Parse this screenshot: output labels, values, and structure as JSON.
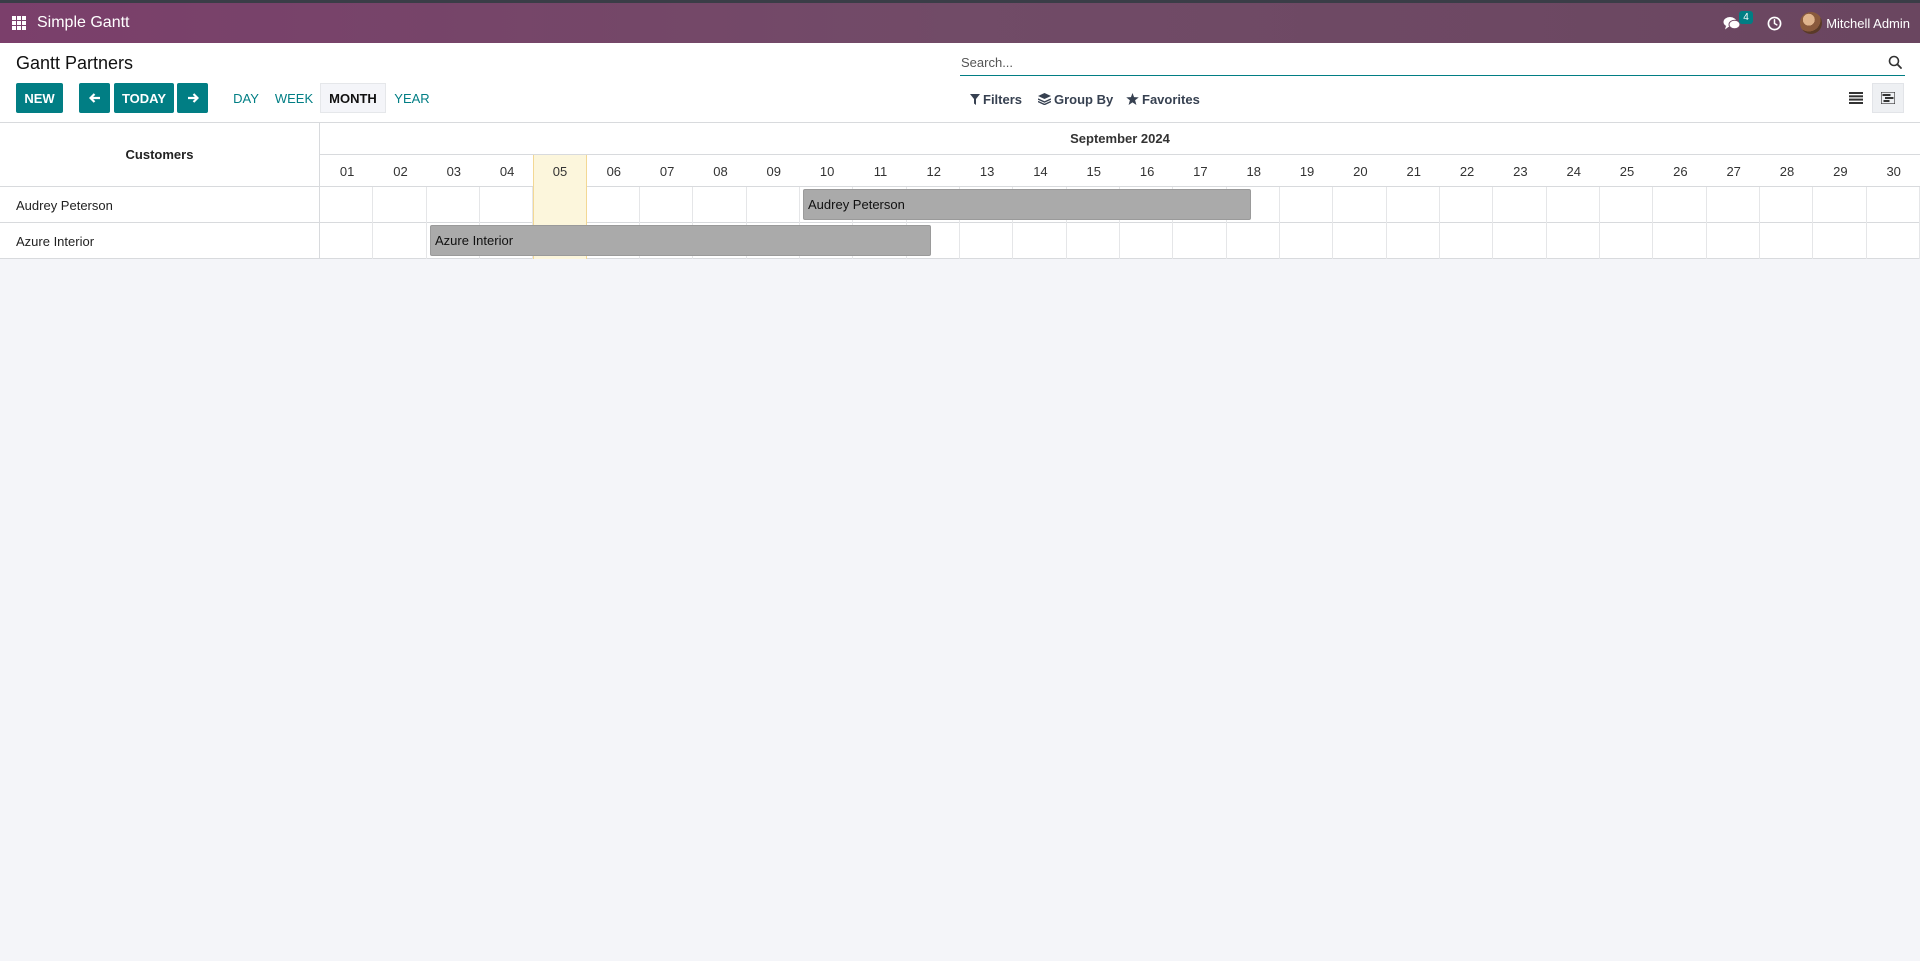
{
  "navbar": {
    "app_title": "Simple Gantt",
    "chat_badge": "4",
    "user_name": "Mitchell Admin",
    "icons": [
      "apps-grid-icon",
      "chat-icon",
      "clock-icon",
      "avatar"
    ]
  },
  "control": {
    "page_title": "Gantt Partners",
    "new_label": "NEW",
    "today_label": "TODAY",
    "scales": [
      "DAY",
      "WEEK",
      "MONTH",
      "YEAR"
    ],
    "active_scale": "MONTH",
    "search_placeholder": "Search...",
    "filters_label": "Filters",
    "groupby_label": "Group By",
    "favorites_label": "Favorites"
  },
  "gantt": {
    "row_header": "Customers",
    "month_label": "September 2024",
    "today_day": "05",
    "days": [
      "01",
      "02",
      "03",
      "04",
      "05",
      "06",
      "07",
      "08",
      "09",
      "10",
      "11",
      "12",
      "13",
      "14",
      "15",
      "16",
      "17",
      "18",
      "19",
      "20",
      "21",
      "22",
      "23",
      "24",
      "25",
      "26",
      "27",
      "28",
      "29",
      "30"
    ],
    "rows": [
      {
        "label": "Audrey Peterson",
        "pill": "Audrey Peterson"
      },
      {
        "label": "Azure Interior",
        "pill": "Azure Interior"
      }
    ]
  },
  "colors": {
    "brand": "#714B67",
    "accent": "#017e84",
    "pill": "#aaaaaa",
    "today": "#fcf6dc"
  }
}
